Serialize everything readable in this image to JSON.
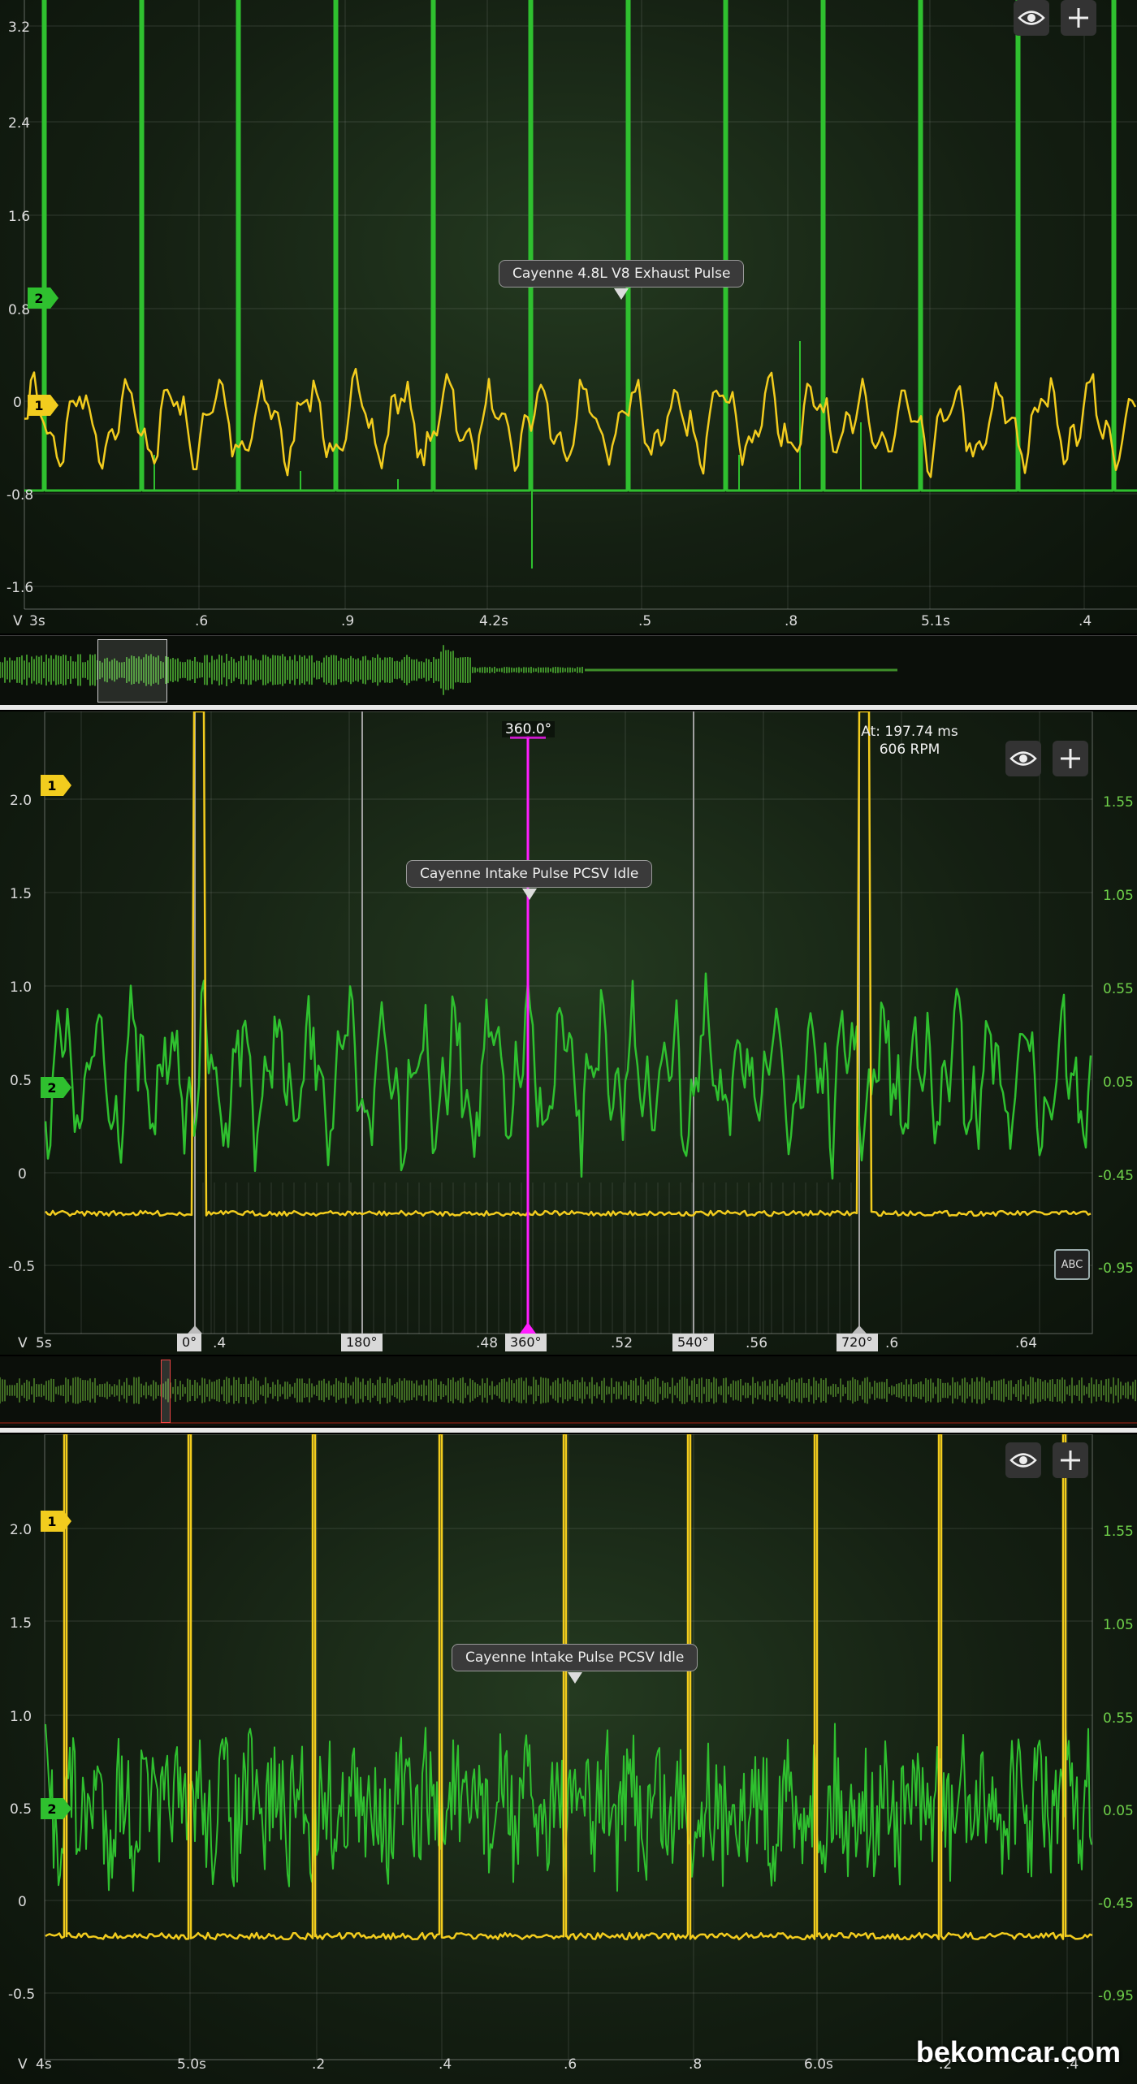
{
  "panel1": {
    "title": "Cayenne 4.8L V8 Exhaust Pulse",
    "y_labels": [
      "3.2",
      "2.4",
      "1.6",
      "0.8",
      "0",
      "-0.8",
      "-1.6"
    ],
    "x_labels": [
      "3s",
      ".6",
      ".9",
      "4.2s",
      ".5",
      ".8",
      "5.1s",
      ".4"
    ],
    "unit": "V",
    "ch1": "1",
    "ch2": "2"
  },
  "panel2": {
    "title": "Cayenne Intake Pulse PCSV Idle",
    "y_labels": [
      "2.0",
      "1.5",
      "1.0",
      "0.5",
      "0",
      "-0.5"
    ],
    "y_right_labels": [
      "1.55",
      "1.05",
      "0.55",
      "0.05",
      "-0.45",
      "-0.95"
    ],
    "x_labels": [
      "5s",
      "0",
      ".4",
      ".48",
      ".52",
      ".56",
      ".6",
      ".64"
    ],
    "unit": "V",
    "cursor_label": "360.0°",
    "readout_time": "At: 197.74 ms",
    "readout_rpm": "606 RPM",
    "degrees": [
      "0°",
      "180°",
      "360°",
      "540°",
      "720°"
    ],
    "abc": "ABC",
    "ch1": "1",
    "ch2": "2"
  },
  "panel3": {
    "title": "Cayenne Intake Pulse PCSV Idle",
    "y_labels": [
      "2.0",
      "1.5",
      "1.0",
      "0.5",
      "0",
      "-0.5"
    ],
    "y_right_labels": [
      "1.55",
      "1.05",
      "0.55",
      "0.05",
      "-0.45",
      "-0.95"
    ],
    "x_labels": [
      "4s",
      "5.0s",
      ".2",
      ".4",
      ".6",
      ".8",
      "6.0s",
      ".2",
      ".4"
    ],
    "unit": "V",
    "ch1": "1",
    "ch2": "2"
  },
  "icons": [
    "eye-icon",
    "plus-icon"
  ],
  "colors": {
    "ch1": "#f2cc1e",
    "ch2": "#2fc02f",
    "cursor": "#ff1eff"
  },
  "watermark": "bekomcar.com"
}
